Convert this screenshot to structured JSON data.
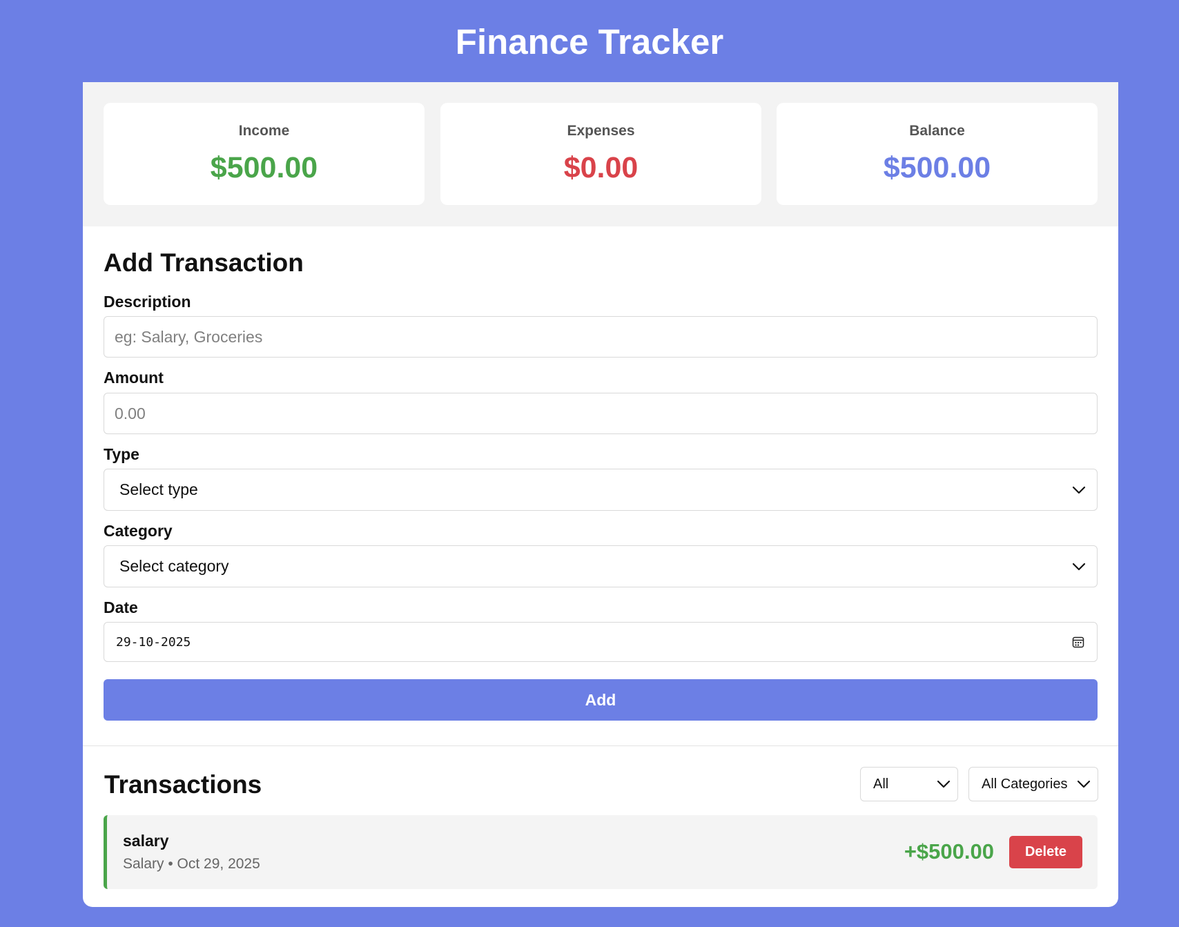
{
  "app": {
    "title": "Finance Tracker"
  },
  "summary": {
    "income": {
      "label": "Income",
      "value": "$500.00",
      "color": "#4aa54a"
    },
    "expenses": {
      "label": "Expenses",
      "value": "$0.00",
      "color": "#d9434a"
    },
    "balance": {
      "label": "Balance",
      "value": "$500.00",
      "color": "#6c7fe5"
    }
  },
  "form": {
    "heading": "Add Transaction",
    "description": {
      "label": "Description",
      "placeholder": "eg: Salary, Groceries",
      "value": ""
    },
    "amount": {
      "label": "Amount",
      "placeholder": "0.00",
      "value": ""
    },
    "type": {
      "label": "Type",
      "selected": "Select type"
    },
    "category": {
      "label": "Category",
      "selected": "Select category"
    },
    "date": {
      "label": "Date",
      "value": "29-10-2025"
    },
    "submit_label": "Add"
  },
  "transactions": {
    "heading": "Transactions",
    "type_filter": "All",
    "category_filter": "All Categories",
    "items": [
      {
        "description": "salary",
        "meta": "Salary • Oct 29, 2025",
        "amount": "+$500.00",
        "delete_label": "Delete"
      }
    ]
  },
  "colors": {
    "brand": "#6c7fe5",
    "income": "#4aa54a",
    "expense": "#d9434a"
  }
}
